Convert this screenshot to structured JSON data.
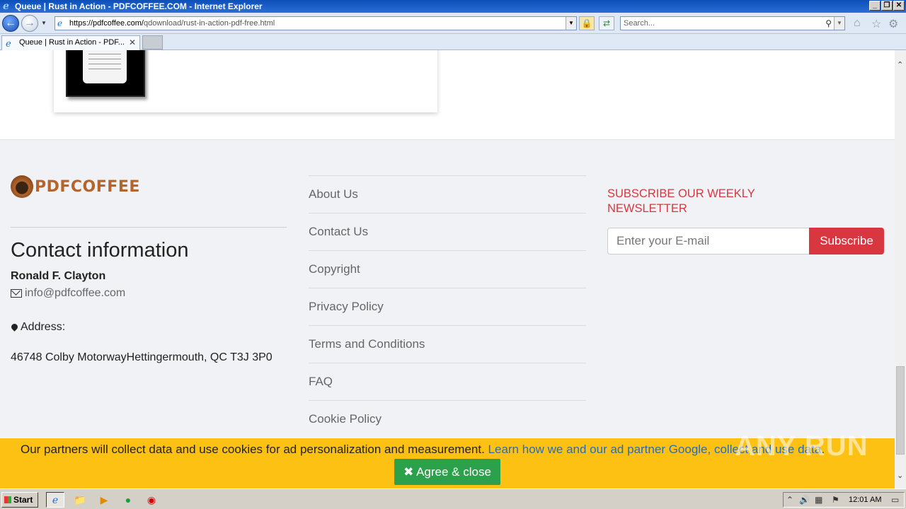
{
  "window": {
    "title": "Queue | Rust in Action - PDFCOFFEE.COM - Internet Explorer",
    "controls": [
      "_",
      "❐",
      "✕"
    ]
  },
  "navbar": {
    "address_host": "https://pdfcoffee.com/",
    "address_path": "qdownload/rust-in-action-pdf-free.html",
    "search_placeholder": "Search..."
  },
  "tabs": [
    {
      "label": "Queue | Rust in Action - PDF..."
    }
  ],
  "footer": {
    "logo_text": "PDFCOFFEE",
    "contact": {
      "title": "Contact information",
      "name": "Ronald F. Clayton",
      "email": "info@pdfcoffee.com",
      "address_label": "Address:",
      "address": "46748 Colby MotorwayHettingermouth, QC T3J 3P0"
    },
    "links": [
      "About Us",
      "Contact Us",
      "Copyright",
      "Privacy Policy",
      "Terms and Conditions",
      "FAQ",
      "Cookie Policy"
    ],
    "newsletter": {
      "title": "SUBSCRIBE OUR WEEKLY NEWSLETTER",
      "input_placeholder": "Enter your E-mail",
      "button_label": "Subscribe"
    }
  },
  "cookie_banner": {
    "text": "Our partners will collect data and use cookies for ad personalization and measurement.",
    "link_text": "Learn how we and our ad partner Google, collect and use data",
    "after_link": ".",
    "button_label": "Agree & close"
  },
  "watermark": "ANY RUN",
  "taskbar": {
    "start_label": "Start",
    "clock": "12:01 AM"
  },
  "colors": {
    "brand": "#b5652b",
    "accent_red": "#d9373f",
    "cookie_bg": "#fcc112",
    "agree_green": "#2aa14a",
    "link_blue": "#2b6cb0"
  }
}
